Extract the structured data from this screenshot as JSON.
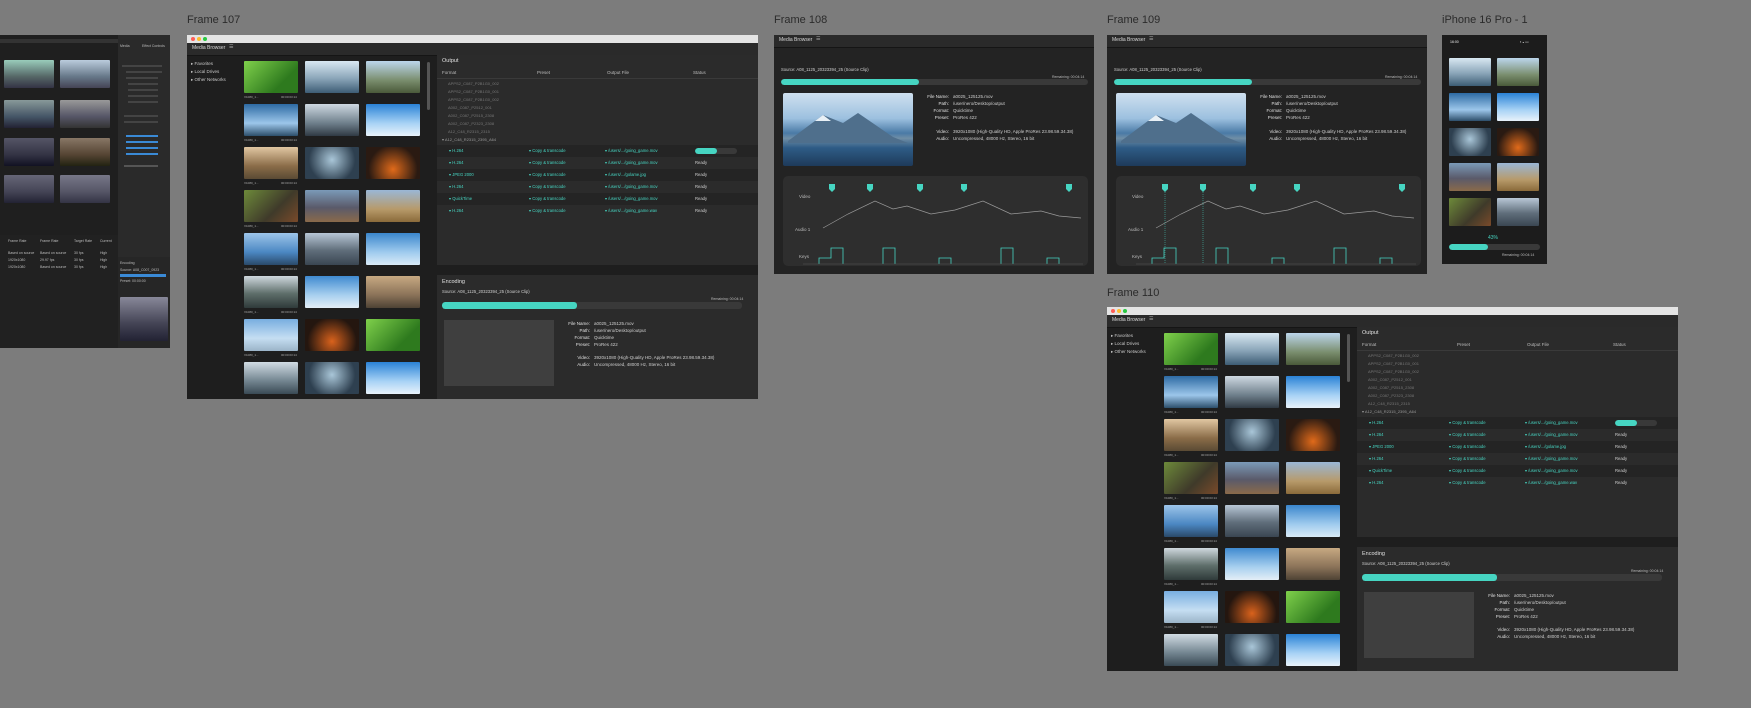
{
  "frames": {
    "f107": "Frame 107",
    "f108": "Frame 108",
    "f109": "Frame 109",
    "f110": "Frame 110",
    "iphone": "iPhone 16 Pro - 1"
  },
  "media_browser": {
    "title": "Media Browser",
    "tree": [
      "Favorites",
      "Local Drives",
      "Other Networks"
    ],
    "thumb_label": "V1080_1...",
    "thumb_time": "00:00:03:14"
  },
  "output": {
    "title": "Output",
    "columns": [
      "Format",
      "Preset",
      "Output File",
      "Status"
    ],
    "sources": [
      "APPS2_C087_P2B1G0_002",
      "APPS2_C087_P2B1G0_001",
      "APPS2_C087_P2B1G0_002",
      "A002_C087_P2512_001",
      "A002_C087_P2515_2308",
      "A002_C087_P2323_2308",
      "A12_C48_R2315_2315",
      "A12_C48_R2315_2395_A64"
    ],
    "jobs": [
      {
        "format": "H.264",
        "preset": "Copy & transcode",
        "file": "/users/.../going_game.mov",
        "status": ""
      },
      {
        "format": "H.264",
        "preset": "Copy & transcode",
        "file": "/users/.../going_game.mov",
        "status": "Ready"
      },
      {
        "format": "JPEG 2000",
        "preset": "Copy & transcode",
        "file": "/users/.../golame.jpg",
        "status": "Ready"
      },
      {
        "format": "H.264",
        "preset": "Copy & transcode",
        "file": "/users/.../going_game.mov",
        "status": "Ready"
      },
      {
        "format": "QuickTime",
        "preset": "Copy & transcode",
        "file": "/users/.../going_game.mov",
        "status": "Ready"
      },
      {
        "format": "H.264",
        "preset": "Copy & transcode",
        "file": "/users/.../going_game.wav",
        "status": "Ready"
      }
    ]
  },
  "encoding": {
    "title": "Encoding",
    "source": "Source: A08_1125_20323394_25 (Source Clip)",
    "remaining": "Remaining: 00:04:14",
    "progress": 0.45,
    "fields": [
      {
        "k": "File Name:",
        "v": "a0025_125125.mov"
      },
      {
        "k": "Path:",
        "v": "/user/nero/Desktop/output"
      },
      {
        "k": "Format:",
        "v": "Quicktime"
      },
      {
        "k": "Preset:",
        "v": "ProRes 422"
      }
    ],
    "video_k": "Video:",
    "video_v": "3920x1080 (High-Quality HD, Apple ProRes 23.98.59.34.38)",
    "audio_k": "Audio:",
    "audio_v": "Uncompressed, 48000 Hz, Stereo, 16 bit"
  },
  "timeline": {
    "labels": [
      "Video",
      "Audio 1",
      "Keys"
    ]
  },
  "phone": {
    "time": "16:00",
    "percent": "43%",
    "progress": 0.43,
    "remaining": "Remaining: 00:04:14"
  },
  "left_partial": {
    "tabs": [
      "Media",
      "Effect Controls"
    ],
    "cols": [
      "Frame Rate",
      "Frame Rate",
      "Target Rate",
      "Current"
    ],
    "rows": [
      [
        "Based on source",
        "Based on source",
        "30 fps",
        "High"
      ],
      [
        "1920x1080",
        "29.97 fps",
        "30 fps",
        "High"
      ],
      [
        "1920x1080",
        "Based on source",
        "30 fps",
        "High"
      ]
    ],
    "encoding_title": "Encoding",
    "encoding_item": "Source: A08_C007_0923",
    "encoding_preset": "Preset: 00:00:00"
  },
  "colors": {
    "accent": "#46d5c2",
    "panel": "#2b2b2b",
    "bg": "#7c7c7c"
  }
}
